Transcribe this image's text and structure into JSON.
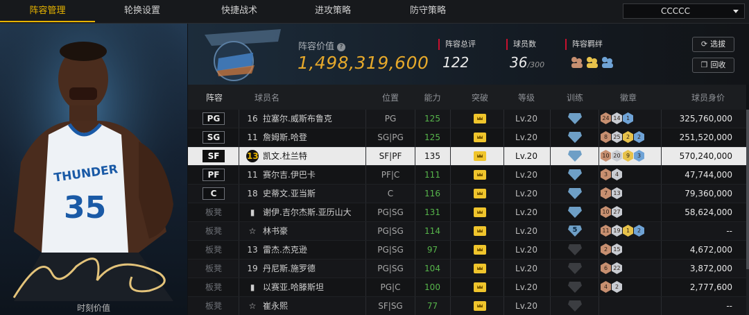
{
  "nav": {
    "tabs": [
      "阵容管理",
      "轮换设置",
      "快捷战术",
      "进攻策略",
      "防守策略"
    ],
    "active_index": 0,
    "team_select": "CCCCC"
  },
  "left_panel": {
    "caption": "时刻价值"
  },
  "header": {
    "value_label": "阵容价值",
    "value": "1,498,319,600",
    "total_rating_label": "阵容总评",
    "total_rating": "122",
    "player_count_label": "球员数",
    "player_count": "36",
    "player_count_max": "/300",
    "bond_label": "阵容羁绊",
    "pick_button": "选拔",
    "recycle_button": "回收"
  },
  "table": {
    "columns": [
      "阵容",
      "球员名",
      "位置",
      "能力",
      "突破",
      "等级",
      "训练",
      "徽章",
      "球员身价"
    ],
    "rows": [
      {
        "slot": "PG",
        "starter": true,
        "num": "16",
        "name": "拉塞尔.威斯布鲁克",
        "pos": "PG",
        "ability": "125",
        "level": "Lv.20",
        "train": "",
        "badges": [
          [
            "b",
            "24"
          ],
          [
            "s",
            "14"
          ],
          [
            "h",
            "1"
          ]
        ],
        "salary": "325,760,000"
      },
      {
        "slot": "SG",
        "starter": true,
        "num": "11",
        "name": "詹姆斯.哈登",
        "pos": "SG|PG",
        "ability": "125",
        "level": "Lv.20",
        "train": "",
        "badges": [
          [
            "b",
            "8"
          ],
          [
            "s",
            "25"
          ],
          [
            "g",
            "2"
          ],
          [
            "h",
            "2"
          ]
        ],
        "salary": "251,520,000"
      },
      {
        "slot": "SF",
        "starter": true,
        "num": "13",
        "name": "凯文.杜兰特",
        "pos": "SF|PF",
        "ability": "135",
        "level": "Lv.20",
        "train": "",
        "badges": [
          [
            "b",
            "10"
          ],
          [
            "s",
            "20"
          ],
          [
            "g",
            "9"
          ],
          [
            "h",
            "3"
          ]
        ],
        "salary": "570,240,000",
        "selected": true
      },
      {
        "slot": "PF",
        "starter": true,
        "num": "11",
        "name": "赛尔吉.伊巴卡",
        "pos": "PF|C",
        "ability": "111",
        "level": "Lv.20",
        "train": "",
        "badges": [
          [
            "b",
            "3"
          ],
          [
            "s",
            "4"
          ]
        ],
        "salary": "47,744,000"
      },
      {
        "slot": "C",
        "starter": true,
        "num": "18",
        "name": "史蒂文.亚当斯",
        "pos": "C",
        "ability": "116",
        "level": "Lv.20",
        "train": "",
        "badges": [
          [
            "b",
            "7"
          ],
          [
            "s",
            "13"
          ]
        ],
        "salary": "79,360,000"
      },
      {
        "slot": "板凳",
        "starter": false,
        "num": "",
        "name": "谢伊.吉尔杰斯.亚历山大",
        "pos": "PG|SG",
        "ability": "131",
        "level": "Lv.20",
        "train": "",
        "badges": [
          [
            "b",
            "10"
          ],
          [
            "s",
            "27"
          ]
        ],
        "salary": "58,624,000"
      },
      {
        "slot": "板凳",
        "starter": false,
        "num": "",
        "name": "林书豪",
        "pos": "PG|SG",
        "ability": "114",
        "level": "Lv.20",
        "train": "5",
        "badges": [
          [
            "b",
            "11"
          ],
          [
            "s",
            "19"
          ],
          [
            "g",
            "1"
          ],
          [
            "h",
            "2"
          ]
        ],
        "salary": "--"
      },
      {
        "slot": "板凳",
        "starter": false,
        "num": "13",
        "name": "雷杰.杰克逊",
        "pos": "PG|SG",
        "ability": "97",
        "level": "Lv.20",
        "train": "grey",
        "badges": [
          [
            "b",
            "2"
          ],
          [
            "s",
            "15"
          ]
        ],
        "salary": "4,672,000"
      },
      {
        "slot": "板凳",
        "starter": false,
        "num": "19",
        "name": "丹尼斯.施罗德",
        "pos": "PG|SG",
        "ability": "104",
        "level": "Lv.20",
        "train": "grey",
        "badges": [
          [
            "b",
            "6"
          ],
          [
            "s",
            "22"
          ]
        ],
        "salary": "3,872,000"
      },
      {
        "slot": "板凳",
        "starter": false,
        "num": "",
        "name": "以赛亚.哈滕斯坦",
        "pos": "PG|C",
        "ability": "100",
        "level": "Lv.20",
        "train": "grey",
        "badges": [
          [
            "b",
            "4"
          ],
          [
            "s",
            "2"
          ]
        ],
        "salary": "2,777,600"
      },
      {
        "slot": "板凳",
        "starter": false,
        "num": "",
        "name": "崔永熙",
        "pos": "SF|SG",
        "ability": "77",
        "level": "Lv.20",
        "train": "grey",
        "badges": [],
        "salary": "--"
      }
    ]
  }
}
